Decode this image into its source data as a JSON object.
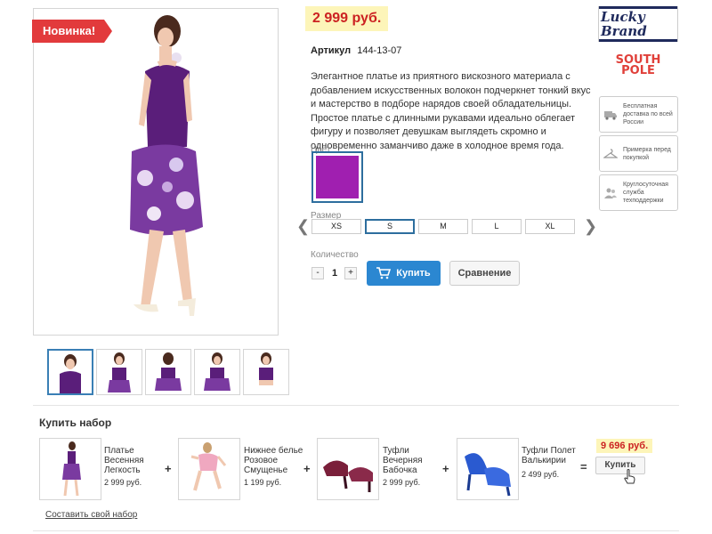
{
  "product": {
    "badge": "Новинка!",
    "price": "2 999 руб.",
    "article_label": "Артикул",
    "article_value": "144-13-07",
    "description": "Элегантное платье из приятного вискозного материала с добавлением искусственных волокон подчеркнет тонкий вкус и мастерство в подборе нарядов своей обладательницы. Простое платье с длинными рукавами идеально облегает фигуру и позволяет девушкам выглядеть скромно и одновременно заманчиво даже в холодное время года.",
    "color_label": "Цвет",
    "color_hex": "#a01fb0",
    "size_label": "Размер",
    "sizes": [
      "XS",
      "S",
      "M",
      "L",
      "XL"
    ],
    "selected_size": "S",
    "qty_label": "Количество",
    "qty_minus": "-",
    "qty_value": "1",
    "qty_plus": "+",
    "buy_label": "Купить",
    "compare_label": "Сравнение"
  },
  "brands": {
    "lucky": "Lucky Brand",
    "south_line1": "SOUTH",
    "south_line2": "POLE"
  },
  "services": [
    "Бесплатная доставка по всей России",
    "Примерка перед покупкой",
    "Круглосуточная служба техподдержки"
  ],
  "set": {
    "title": "Купить набор",
    "items": [
      {
        "name": "Платье Весенняя Легкость",
        "price": "2 999 руб."
      },
      {
        "name": "Нижнее белье Розовое Смущенье",
        "price": "1 199 руб."
      },
      {
        "name": "Туфли Вечерняя Бабочка",
        "price": "2 999 руб."
      },
      {
        "name": "Туфли Полет Валькирии",
        "price": "2 499 руб."
      }
    ],
    "plus": "+",
    "equals": "=",
    "total": "9 696 руб.",
    "buy_label": "Купить",
    "make_own": "Составить свой набор"
  },
  "colors": {
    "price_bg": "#fdf5b9",
    "price_text": "#cc2222",
    "badge": "#e23a3c",
    "buy_button": "#2b87d1",
    "selection_border": "#2d6e9e"
  }
}
